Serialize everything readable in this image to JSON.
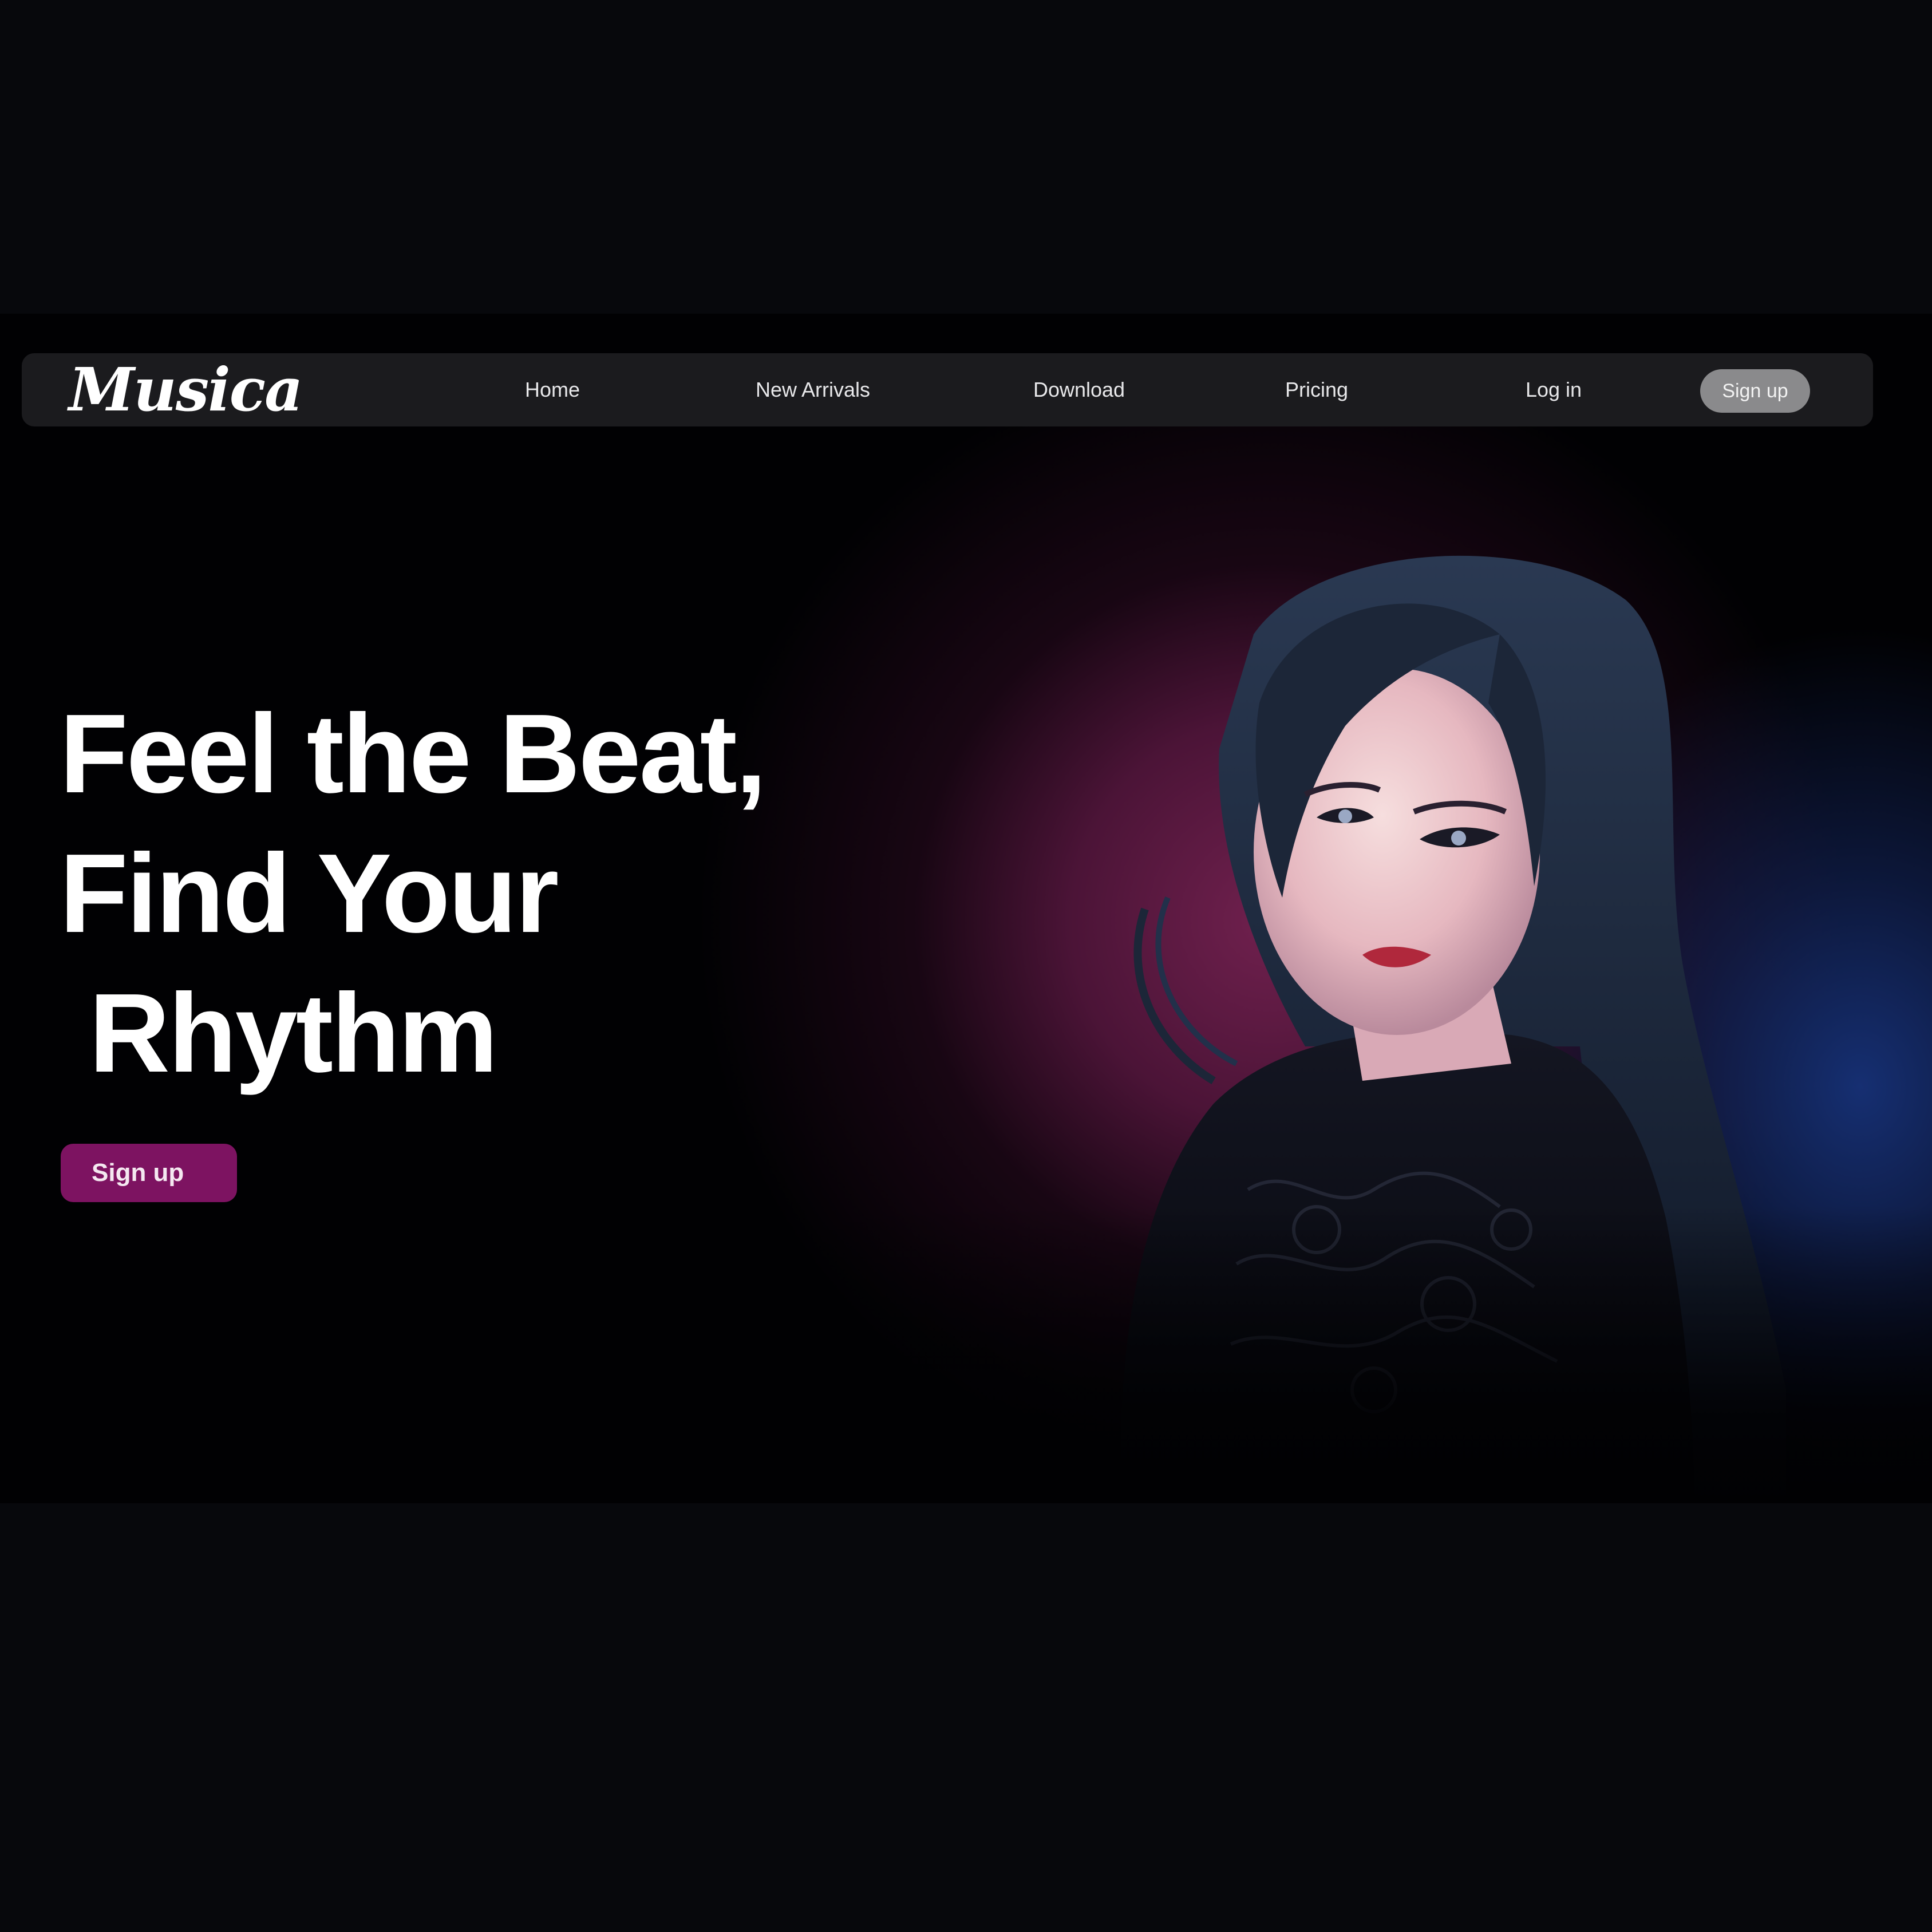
{
  "app": {
    "logo_text": "Musica"
  },
  "nav": {
    "items": [
      {
        "label": "Home"
      },
      {
        "label": "New Arrivals"
      },
      {
        "label": "Download"
      },
      {
        "label": "Pricing"
      },
      {
        "label": "Log in"
      }
    ],
    "signup_label": "Sign up"
  },
  "hero": {
    "headline_lines": [
      "Feel the Beat,",
      "Find Your",
      " Rhythm"
    ],
    "cta_label": "Sign up"
  },
  "colors": {
    "background": "#07080c",
    "nav_background": "#1b1b1e",
    "accent": "#7d1361",
    "glow_magenta": "#762252",
    "glow_blue": "#18347e"
  }
}
